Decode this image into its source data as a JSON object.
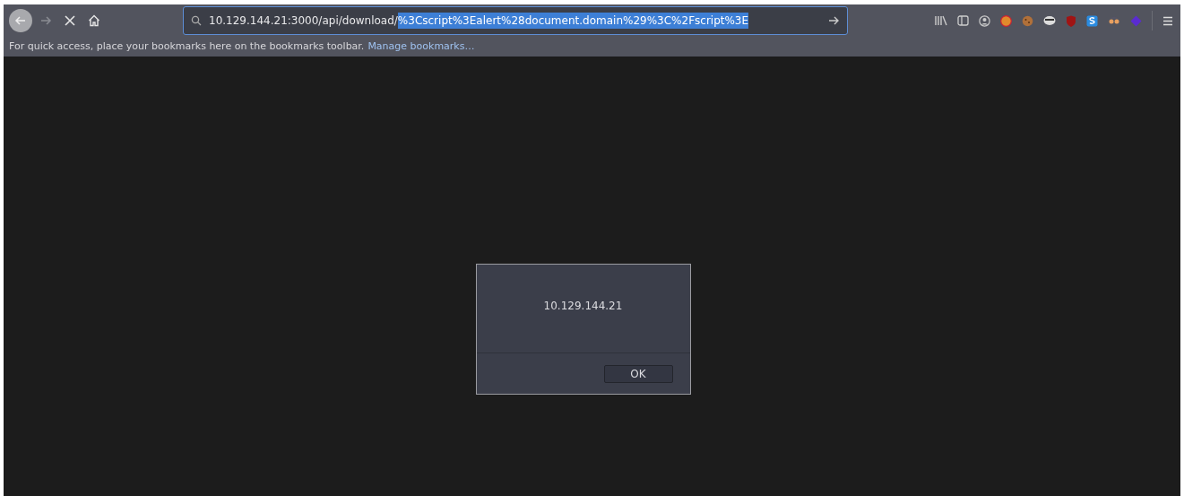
{
  "address_bar": {
    "url": "10.129.144.21:3000/api/download/",
    "selected_text": "%3Cscript%3Ealert%28document.domain%29%3C%2Fscript%3E"
  },
  "bookmarks_bar": {
    "message": "For quick access, place your bookmarks here on the bookmarks toolbar.",
    "link": "Manage bookmarks…"
  },
  "alert_dialog": {
    "message": "10.129.144.21",
    "button": "OK"
  }
}
